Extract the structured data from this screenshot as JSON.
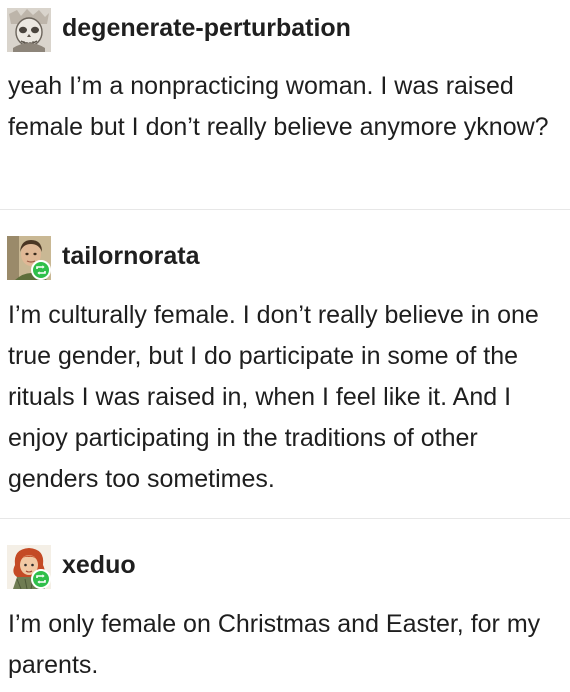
{
  "posts": [
    {
      "username": "degenerate-perturbation",
      "avatar_icon": "skull-portrait-avatar-icon",
      "reblogged": false,
      "text": "yeah I’m a nonpracticing woman. I was raised female but I don’t really believe anymore yknow?"
    },
    {
      "username": "tailornorata",
      "avatar_icon": "person-portrait-avatar-icon",
      "reblogged": true,
      "text": "I’m culturally female. I don’t really believe in one true gender, but I do participate in some of the rituals I was raised in, when I feel like it. And I enjoy participating in the traditions of other genders too sometimes."
    },
    {
      "username": "xeduo",
      "avatar_icon": "redhead-portrait-avatar-icon",
      "reblogged": true,
      "text": "I’m only female on Christmas and Easter, for my parents."
    }
  ],
  "colors": {
    "reblog_badge": "#2fbf4a",
    "divider": "#e7e7e7",
    "text": "#1e1e1e"
  }
}
